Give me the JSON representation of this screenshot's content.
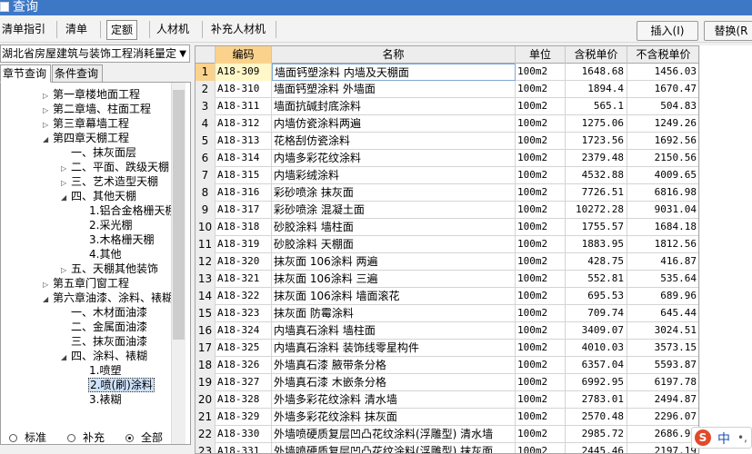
{
  "window": {
    "title": "查询"
  },
  "tabs": [
    {
      "label": "清单指引"
    },
    {
      "label": "清单"
    },
    {
      "label": "定额"
    },
    {
      "label": "人材机"
    },
    {
      "label": "补充人材机"
    }
  ],
  "actions": {
    "insert": "插入(I)",
    "replace": "替换(R"
  },
  "left": {
    "library": "湖北省房屋建筑与装饰工程消耗量定",
    "subtabs": [
      "章节查询",
      "条件查询"
    ],
    "tree": [
      {
        "label": "第一章楼地面工程",
        "toggle": "▷"
      },
      {
        "label": "第二章墙、柱面工程",
        "toggle": "▷"
      },
      {
        "label": "第三章幕墙工程",
        "toggle": "▷"
      },
      {
        "label": "第四章天棚工程",
        "toggle": "◢"
      },
      {
        "label": "一、抹灰面层",
        "toggle": ""
      },
      {
        "label": "二、平面、跌级天棚",
        "toggle": "▷"
      },
      {
        "label": "三、艺术造型天棚",
        "toggle": "▷"
      },
      {
        "label": "四、其他天棚",
        "toggle": "◢"
      },
      {
        "label": "1.铝合金格栅天棚",
        "toggle": ""
      },
      {
        "label": "2.采光棚",
        "toggle": ""
      },
      {
        "label": "3.木格栅天棚",
        "toggle": ""
      },
      {
        "label": "4.其他",
        "toggle": ""
      },
      {
        "label": "五、天棚其他装饰",
        "toggle": "▷"
      },
      {
        "label": "第五章门窗工程",
        "toggle": "▷"
      },
      {
        "label": "第六章油漆、涂料、裱糊",
        "toggle": "◢"
      },
      {
        "label": "一、木材面油漆",
        "toggle": ""
      },
      {
        "label": "二、金属面油漆",
        "toggle": ""
      },
      {
        "label": "三、抹灰面油漆",
        "toggle": ""
      },
      {
        "label": "四、涂料、裱糊",
        "toggle": "◢"
      },
      {
        "label": "1.喷塑",
        "toggle": ""
      },
      {
        "label": "2.喷(刷)涂料",
        "toggle": ""
      },
      {
        "label": "3.裱糊",
        "toggle": ""
      }
    ],
    "radios": [
      {
        "label": "标准",
        "checked": false
      },
      {
        "label": "补充",
        "checked": false
      },
      {
        "label": "全部",
        "checked": true
      }
    ]
  },
  "table": {
    "columns": [
      "",
      "编码",
      "名称",
      "单位",
      "含税单价",
      "不含税单价"
    ],
    "rows": [
      [
        "1",
        "A18-309",
        "墙面钙塑涂料 内墙及天棚面",
        "100m2",
        "1648.68",
        "1456.03"
      ],
      [
        "2",
        "A18-310",
        "墙面钙塑涂料 外墙面",
        "100m2",
        "1894.4",
        "1670.47"
      ],
      [
        "3",
        "A18-311",
        "墙面抗碱封底涂料",
        "100m2",
        "565.1",
        "504.83"
      ],
      [
        "4",
        "A18-312",
        "内墙仿瓷涂料两遍",
        "100m2",
        "1275.06",
        "1249.26"
      ],
      [
        "5",
        "A18-313",
        "花格刮仿瓷涂料",
        "100m2",
        "1723.56",
        "1692.56"
      ],
      [
        "6",
        "A18-314",
        "内墙多彩花纹涂料",
        "100m2",
        "2379.48",
        "2150.56"
      ],
      [
        "7",
        "A18-315",
        "内墙彩绒涂料",
        "100m2",
        "4532.88",
        "4009.65"
      ],
      [
        "8",
        "A18-316",
        "彩砂喷涂 抹灰面",
        "100m2",
        "7726.51",
        "6816.98"
      ],
      [
        "9",
        "A18-317",
        "彩砂喷涂 混凝土面",
        "100m2",
        "10272.28",
        "9031.04"
      ],
      [
        "10",
        "A18-318",
        "砂胶涂料 墙柱面",
        "100m2",
        "1755.57",
        "1684.18"
      ],
      [
        "11",
        "A18-319",
        "砂胶涂料 天棚面",
        "100m2",
        "1883.95",
        "1812.56"
      ],
      [
        "12",
        "A18-320",
        "抹灰面 106涂料 两遍",
        "100m2",
        "428.75",
        "416.87"
      ],
      [
        "13",
        "A18-321",
        "抹灰面 106涂料 三遍",
        "100m2",
        "552.81",
        "535.64"
      ],
      [
        "14",
        "A18-322",
        "抹灰面 106涂料 墙面滚花",
        "100m2",
        "695.53",
        "689.96"
      ],
      [
        "15",
        "A18-323",
        "抹灰面 防霉涂料",
        "100m2",
        "709.74",
        "645.44"
      ],
      [
        "16",
        "A18-324",
        "内墙真石涂料 墙柱面",
        "100m2",
        "3409.07",
        "3024.51"
      ],
      [
        "17",
        "A18-325",
        "内墙真石涂料 装饰线零星构件",
        "100m2",
        "4010.03",
        "3573.15"
      ],
      [
        "18",
        "A18-326",
        "外墙真石漆 腋带条分格",
        "100m2",
        "6357.04",
        "5593.87"
      ],
      [
        "19",
        "A18-327",
        "外墙真石漆 木嵌条分格",
        "100m2",
        "6992.95",
        "6197.78"
      ],
      [
        "20",
        "A18-328",
        "外墙多彩花纹涂料 清水墙",
        "100m2",
        "2783.01",
        "2494.87"
      ],
      [
        "21",
        "A18-329",
        "外墙多彩花纹涂料 抹灰面",
        "100m2",
        "2570.48",
        "2296.07"
      ],
      [
        "22",
        "A18-330",
        "外墙喷硬质复层凹凸花纹涂料(浮雕型) 清水墙",
        "100m2",
        "2985.72",
        "2686.97"
      ],
      [
        "23",
        "A18-331",
        "外墙喷硬质复层凹凸花纹涂料(浮雕型) 抹灰面",
        "100m2",
        "2445.46",
        "2197.19"
      ]
    ]
  },
  "ime": {
    "logo": "S",
    "lang": "中",
    "punct": "•,"
  }
}
